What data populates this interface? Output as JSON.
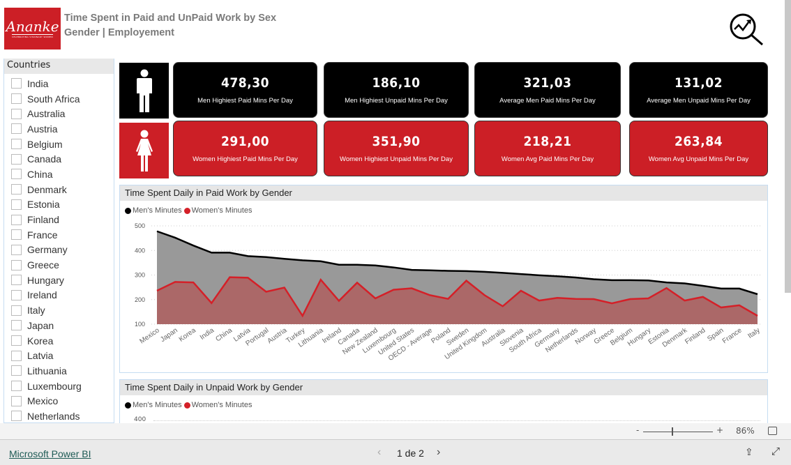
{
  "header": {
    "logo_text": "Ananke",
    "logo_tagline": "CELEBRATING VISIONARY WOMEN",
    "title_line1": "Time Spent in Paid and UnPaid Work by Sex",
    "title_line2": "Gender | Employement",
    "icon": "magnifier-trend-icon"
  },
  "slicer": {
    "title": "Countries",
    "items": [
      "India",
      "South Africa",
      "Australia",
      "Austria",
      "Belgium",
      "Canada",
      "China",
      "Denmark",
      "Estonia",
      "Finland",
      "France",
      "Germany",
      "Greece",
      "Hungary",
      "Ireland",
      "Italy",
      "Japan",
      "Korea",
      "Latvia",
      "Lithuania",
      "Luxembourg",
      "Mexico",
      "Netherlands"
    ]
  },
  "kpis": {
    "men": [
      {
        "value": "478,30",
        "label": "Men Highiest Paid Mins Per Day"
      },
      {
        "value": "186,10",
        "label": "Men Highiest Unpaid Mins Per Day"
      },
      {
        "value": "321,03",
        "label": "Average Men Paid Mins Per Day"
      },
      {
        "value": "131,02",
        "label": "Average Men Unpaid Mins Per Day"
      }
    ],
    "women": [
      {
        "value": "291,00",
        "label": "Women Highiest Paid Mins Per Day"
      },
      {
        "value": "351,90",
        "label": "Women Highiest Unpaid Mins Per Day"
      },
      {
        "value": "218,21",
        "label": "Women Avg Paid Mins Per Day"
      },
      {
        "value": "263,84",
        "label": "Women Avg Unpaid Mins Per Day"
      }
    ]
  },
  "colors": {
    "men": "#000000",
    "women": "#d42028",
    "men_area": "#999999",
    "women_area": "#ab6868",
    "brand_red": "#cc1f26"
  },
  "chart_data": [
    {
      "type": "area",
      "title": "Time Spent Daily in Paid Work by Gender",
      "ylim": [
        100,
        500
      ],
      "yticks": [
        100,
        200,
        300,
        400,
        500
      ],
      "grid": true,
      "legend": "top-left",
      "categories": [
        "Mexico",
        "Japan",
        "Korea",
        "India",
        "China",
        "Latvia",
        "Portugal",
        "Austria",
        "Turkey",
        "Lithuania",
        "Ireland",
        "Canada",
        "New Zealand",
        "Luxembourg",
        "United States",
        "OECD - Average",
        "Poland",
        "Sweden",
        "United Kingdom",
        "Australia",
        "Slovenia",
        "South Africa",
        "Germany",
        "Netherlands",
        "Norway",
        "Greece",
        "Belgium",
        "Hungary",
        "Estonia",
        "Denmark",
        "Finland",
        "Spain",
        "France",
        "Italy"
      ],
      "series": [
        {
          "name": "Men's Minutes",
          "values": [
            478,
            452,
            420,
            391,
            391,
            377,
            373,
            366,
            360,
            356,
            342,
            342,
            339,
            331,
            321,
            319,
            317,
            316,
            313,
            309,
            304,
            299,
            295,
            290,
            283,
            279,
            279,
            278,
            270,
            266,
            256,
            245,
            245,
            222
          ]
        },
        {
          "name": "Women's Minutes",
          "values": [
            236,
            272,
            270,
            186,
            291,
            289,
            232,
            249,
            134,
            281,
            195,
            269,
            205,
            240,
            246,
            218,
            203,
            277,
            218,
            173,
            236,
            196,
            207,
            203,
            202,
            185,
            202,
            205,
            247,
            196,
            211,
            168,
            177,
            134
          ]
        }
      ]
    },
    {
      "type": "area",
      "title": "Time Spent Daily in Unpaid Work by Gender",
      "yticks": [
        400
      ],
      "legend": "top-left",
      "series": [
        {
          "name": "Men's Minutes"
        },
        {
          "name": "Women's Minutes"
        }
      ]
    }
  ],
  "zoom": {
    "minus": "-",
    "plus": "+",
    "level": "86%",
    "value": 0.5
  },
  "footer": {
    "link": "Microsoft Power BI",
    "page": "1 de 2"
  }
}
